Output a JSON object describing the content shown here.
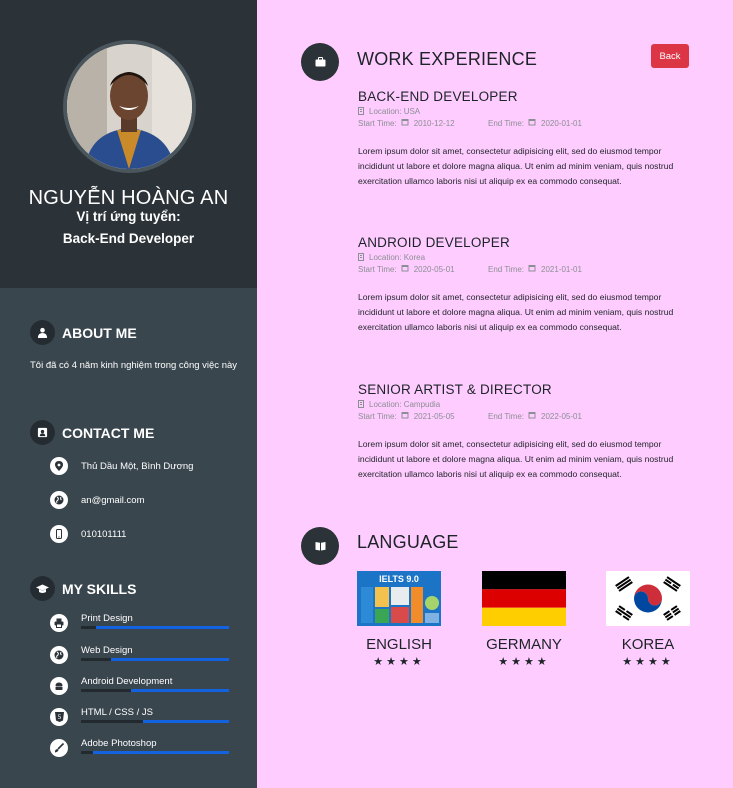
{
  "profile": {
    "name": "NGUYỄN HOÀNG AN",
    "role_label": "Vị trí ứng tuyển:",
    "role_value": "Back-End Developer"
  },
  "about": {
    "title": "ABOUT ME",
    "text": "Tôi đã có 4 năm kinh nghiệm trong công việc này"
  },
  "contact": {
    "title": "CONTACT ME",
    "items": [
      {
        "icon": "location-pin-icon",
        "text": "Thủ Dầu Một, Bình Dương"
      },
      {
        "icon": "globe-icon",
        "text": "an@gmail.com"
      },
      {
        "icon": "mobile-phone-icon",
        "text": "010101111"
      }
    ]
  },
  "skills": {
    "title": "MY SKILLS",
    "items": [
      {
        "icon": "printer-icon",
        "name": "Print Design",
        "level": 0.9
      },
      {
        "icon": "globe-icon",
        "name": "Web Design",
        "level": 0.8
      },
      {
        "icon": "android-icon",
        "name": "Android Development",
        "level": 0.66
      },
      {
        "icon": "html5-icon",
        "name": "HTML / CSS / JS",
        "level": 0.58
      },
      {
        "icon": "paintbrush-icon",
        "name": "Adobe Photoshop",
        "level": 0.92
      }
    ]
  },
  "work": {
    "title": "WORK EXPERIENCE",
    "back_label": "Back",
    "start_label": "Start Time:",
    "end_label": "End Time:",
    "jobs": [
      {
        "title": "BACK-END DEVELOPER",
        "location": "Location: USA",
        "start": "2010-12-12",
        "end": "2020-01-01",
        "desc": "Lorem ipsum dolor sit amet, consectetur adipisicing elit, sed do eiusmod tempor incididunt ut labore et dolore magna aliqua. Ut enim ad minim veniam, quis nostrud exercitation ullamco laboris nisi ut aliquip ex ea commodo consequat."
      },
      {
        "title": "ANDROID DEVELOPER",
        "location": "Location: Korea",
        "start": "2020-05-01",
        "end": "2021-01-01",
        "desc": "Lorem ipsum dolor sit amet, consectetur adipisicing elit, sed do eiusmod tempor incididunt ut labore et dolore magna aliqua. Ut enim ad minim veniam, quis nostrud exercitation ullamco laboris nisi ut aliquip ex ea commodo consequat."
      },
      {
        "title": "SENIOR ARTIST & DIRECTOR",
        "location": "Location: Campudia",
        "start": "2021-05-05",
        "end": "2022-05-01",
        "desc": "Lorem ipsum dolor sit amet, consectetur adipisicing elit, sed do eiusmod tempor incididunt ut labore et dolore magna aliqua. Ut enim ad minim veniam, quis nostrud exercitation ullamco laboris nisi ut aliquip ex ea commodo consequat."
      }
    ]
  },
  "language": {
    "title": "LANGUAGE",
    "items": [
      {
        "name": "ENGLISH",
        "stars": "★★★★",
        "image_text": "IELTS 9.0"
      },
      {
        "name": "GERMANY",
        "stars": "★★★★"
      },
      {
        "name": "KOREA",
        "stars": "★★★★"
      }
    ]
  },
  "colors": {
    "sidebar_top": "#2b3338",
    "sidebar": "#3a464e",
    "main_bg": "#ffccff",
    "skill_bar": "#1363e0",
    "back_button": "#dc3545"
  }
}
